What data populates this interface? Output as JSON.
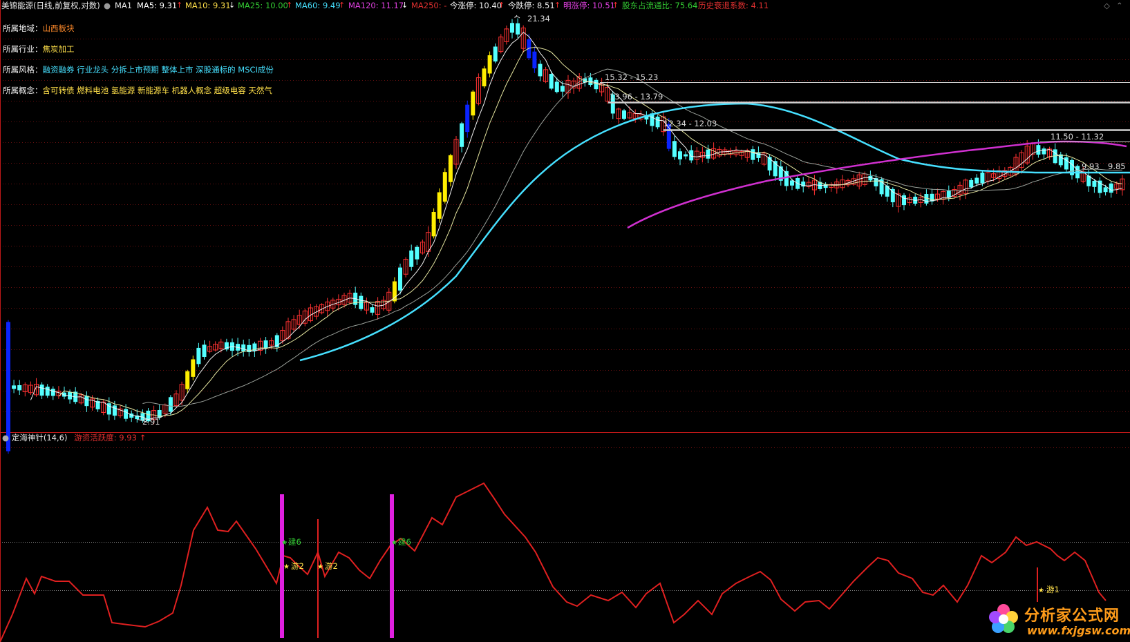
{
  "header": {
    "stock_title": "美锦能源(日线,前复权,对数)",
    "ma1": "MA1",
    "ma5": {
      "label": "MA5: 9.31",
      "arrow": "↑",
      "color": "#ffffff"
    },
    "ma10": {
      "label": "MA10: 9.31",
      "arrow": "↓",
      "color": "#ffe04a"
    },
    "ma25": {
      "label": "MA25: 10.00",
      "arrow": "↑",
      "color": "#33cc33"
    },
    "ma60": {
      "label": "MA60: 9.49",
      "arrow": "↑",
      "color": "#46e0ff"
    },
    "ma120": {
      "label": "MA120: 11.17",
      "arrow": "↓",
      "color": "#e040e0"
    },
    "ma250": {
      "label": "MA250: -",
      "color": "#e03030"
    },
    "limit_up": {
      "label": "今涨停: 10.40",
      "arrow": "↑"
    },
    "limit_down": {
      "label": "今跌停: 8.51",
      "arrow": "↑"
    },
    "next_limit": {
      "label": "明涨停: 10.51",
      "arrow": "↑"
    },
    "float_ratio": {
      "label": "股东占流通比: 75.64"
    },
    "hist_decline": {
      "label": "历史衰退系数: 4.11"
    }
  },
  "info": {
    "region_label": "所属地域：",
    "region_value": "山西板块",
    "industry_label": "所属行业：",
    "industry_value": "焦炭加工",
    "style_label": "所属风格：",
    "style_value": "融资融券 行业龙头 分拆上市预期 整体上市 深股通标的 MSCI成份",
    "concept_label": "所属概念：",
    "concept_value": "含可转债 燃料电池 氢能源 新能源车 机器人概念 超级电容 天然气"
  },
  "price_annotations": {
    "high": "21.34",
    "low": "2.91",
    "gap1": "15.32 - 15.23",
    "gap2": "13.96 - 13.79",
    "gap3": "12.34 - 12.03",
    "gap4": "11.50 - 11.32",
    "pt1": "9.93",
    "pt2": "9.85"
  },
  "indicator": {
    "name": "定海神针(14,6)",
    "param_label": "游资活跃度: 9.93",
    "param_arrow": "↑",
    "signals": [
      "建6",
      "游2",
      "游2",
      "建6",
      "游1"
    ]
  },
  "logo": {
    "title": "分析家公式网",
    "url": "www.fxjgsw.com"
  },
  "colors": {
    "up": "#ff3232",
    "down": "#54ffff",
    "limit_up": "#ffee00",
    "limit_down": "#0a24ff",
    "ma60": "#46e0ff",
    "ma120": "#d030d0",
    "indicator": "#e02020",
    "signal_bar": "#e020e0"
  }
}
